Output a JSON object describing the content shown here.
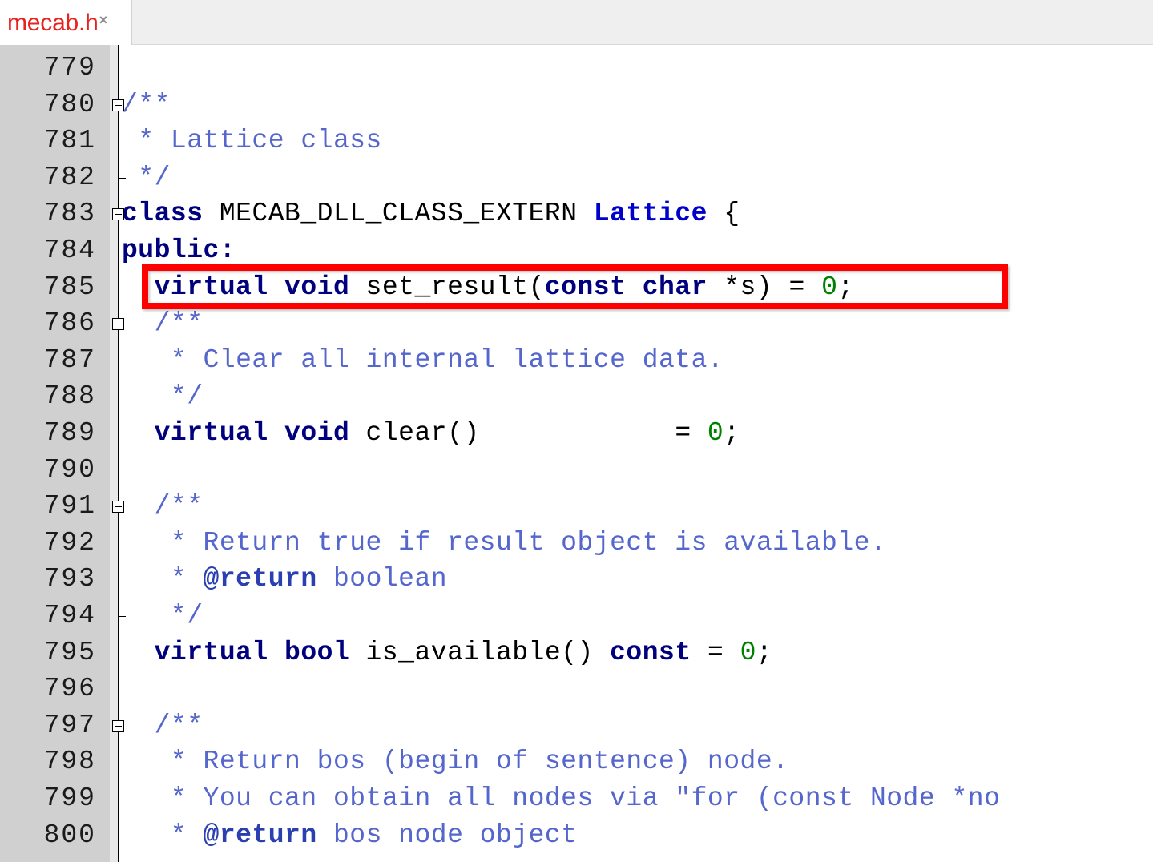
{
  "window": {
    "title": "mecab.h",
    "type": "code-editor"
  },
  "tab": {
    "label": "mecab.h",
    "close_glyph": "×",
    "active": true,
    "label_color": "#e8231f"
  },
  "editor": {
    "gutter_bg": "#d0d0d0",
    "background": "#ffffff",
    "first_visible_line": 779,
    "last_visible_line": 800,
    "syntax_colors": {
      "comment": "#5566cc",
      "comment_tag": "#2a3fb0",
      "keyword": "#00007f",
      "type": "#0000cc",
      "number": "#008000",
      "plain": "#000000"
    },
    "highlight_color": "#fe0000",
    "lines": [
      {
        "no": "779",
        "fold": "none",
        "tokens": []
      },
      {
        "no": "780",
        "fold": "box",
        "tokens": [
          {
            "t": "/**",
            "c": "cm"
          }
        ]
      },
      {
        "no": "781",
        "fold": "bar",
        "tokens": [
          {
            "t": " * Lattice class",
            "c": "cm"
          }
        ]
      },
      {
        "no": "782",
        "fold": "tick",
        "tokens": [
          {
            "t": " */",
            "c": "cm"
          }
        ]
      },
      {
        "no": "783",
        "fold": "box",
        "tokens": [
          {
            "t": "class",
            "c": "kw"
          },
          {
            "t": " MECAB_DLL_CLASS_EXTERN ",
            "c": "pl"
          },
          {
            "t": "Lattice",
            "c": "ty"
          },
          {
            "t": " {",
            "c": "pl"
          }
        ]
      },
      {
        "no": "784",
        "fold": "bar",
        "tokens": [
          {
            "t": "public:",
            "c": "kw"
          }
        ]
      },
      {
        "no": "785",
        "fold": "bar",
        "highlighted": true,
        "tokens": [
          {
            "t": "  ",
            "c": "pl"
          },
          {
            "t": "virtual void",
            "c": "kw"
          },
          {
            "t": " set_result(",
            "c": "pl"
          },
          {
            "t": "const char",
            "c": "kw"
          },
          {
            "t": " *s) = ",
            "c": "pl"
          },
          {
            "t": "0",
            "c": "num"
          },
          {
            "t": ";",
            "c": "pl"
          }
        ]
      },
      {
        "no": "786",
        "fold": "box",
        "tokens": [
          {
            "t": "  /**",
            "c": "cm"
          }
        ]
      },
      {
        "no": "787",
        "fold": "bar",
        "tokens": [
          {
            "t": "   * Clear all internal lattice data.",
            "c": "cm"
          }
        ]
      },
      {
        "no": "788",
        "fold": "tick",
        "tokens": [
          {
            "t": "   */",
            "c": "cm"
          }
        ]
      },
      {
        "no": "789",
        "fold": "bar",
        "tokens": [
          {
            "t": "  ",
            "c": "pl"
          },
          {
            "t": "virtual void",
            "c": "kw"
          },
          {
            "t": " clear()            = ",
            "c": "pl"
          },
          {
            "t": "0",
            "c": "num"
          },
          {
            "t": ";",
            "c": "pl"
          }
        ]
      },
      {
        "no": "790",
        "fold": "bar",
        "tokens": []
      },
      {
        "no": "791",
        "fold": "box",
        "tokens": [
          {
            "t": "  /**",
            "c": "cm"
          }
        ]
      },
      {
        "no": "792",
        "fold": "bar",
        "tokens": [
          {
            "t": "   * Return true if result object is available.",
            "c": "cm"
          }
        ]
      },
      {
        "no": "793",
        "fold": "bar",
        "tokens": [
          {
            "t": "   * ",
            "c": "cm"
          },
          {
            "t": "@return",
            "c": "cmt"
          },
          {
            "t": " boolean",
            "c": "cm"
          }
        ]
      },
      {
        "no": "794",
        "fold": "tick",
        "tokens": [
          {
            "t": "   */",
            "c": "cm"
          }
        ]
      },
      {
        "no": "795",
        "fold": "bar",
        "tokens": [
          {
            "t": "  ",
            "c": "pl"
          },
          {
            "t": "virtual bool",
            "c": "kw"
          },
          {
            "t": " is_available() ",
            "c": "pl"
          },
          {
            "t": "const",
            "c": "kw"
          },
          {
            "t": " = ",
            "c": "pl"
          },
          {
            "t": "0",
            "c": "num"
          },
          {
            "t": ";",
            "c": "pl"
          }
        ]
      },
      {
        "no": "796",
        "fold": "bar",
        "tokens": []
      },
      {
        "no": "797",
        "fold": "box",
        "tokens": [
          {
            "t": "  /**",
            "c": "cm"
          }
        ]
      },
      {
        "no": "798",
        "fold": "bar",
        "tokens": [
          {
            "t": "   * Return bos (begin of sentence) node.",
            "c": "cm"
          }
        ]
      },
      {
        "no": "799",
        "fold": "bar",
        "tokens": [
          {
            "t": "   * You can obtain all nodes via \"for (const Node *no",
            "c": "cm"
          }
        ]
      },
      {
        "no": "800",
        "fold": "bar",
        "tokens": [
          {
            "t": "   * ",
            "c": "cm"
          },
          {
            "t": "@return",
            "c": "cmt"
          },
          {
            "t": " bos node object",
            "c": "cm"
          }
        ]
      }
    ]
  }
}
